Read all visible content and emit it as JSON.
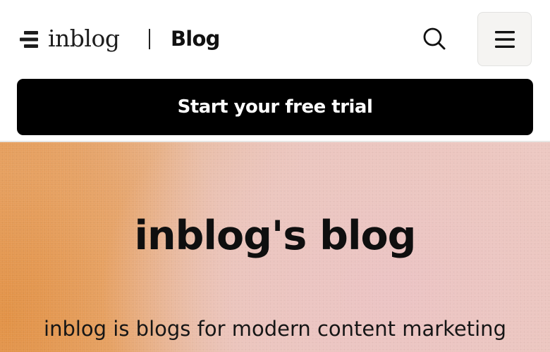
{
  "header": {
    "logo_text": "inblog",
    "section_title": "Blog",
    "search_icon": "search-icon",
    "menu_icon": "hamburger-menu-icon"
  },
  "cta": {
    "label": "Start your free trial"
  },
  "hero": {
    "title": "inblog's blog",
    "subtitle": "inblog is blogs for modern content marketing"
  },
  "colors": {
    "cta_background": "#000000",
    "cta_text": "#ffffff",
    "hero_orange": "#e39a55",
    "hero_pink": "#edc9c3",
    "menu_button_bg": "#f5f4f2"
  }
}
